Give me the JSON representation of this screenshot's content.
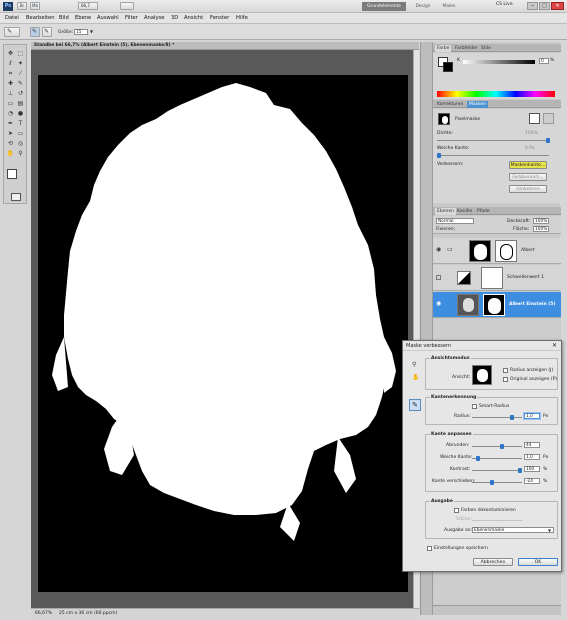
{
  "appbar": {
    "zoom": "66,7",
    "workspace_btn": "Grundelemente",
    "btn_design": "Design",
    "btn_malen": "Malen",
    "cs_live": "CS Live"
  },
  "menu": [
    "Datei",
    "Bearbeiten",
    "Bild",
    "Ebene",
    "Auswahl",
    "Filter",
    "Analyse",
    "3D",
    "Ansicht",
    "Fenster",
    "Hilfe"
  ],
  "options": {
    "size_label": "Größe:",
    "size_value": "15"
  },
  "document": {
    "title": "Standbe bei 66,7% (Albert Einstein (5), Ebenenmaske/8) *",
    "status_zoom": "66,67%",
    "status_info": "25 cm x 36 cm (60 ppcm)"
  },
  "panels": {
    "color_tabs": [
      "Farbe",
      "Farbfelder",
      "Stile"
    ],
    "color_slider_label": "K",
    "color_slider_value": "0",
    "color_slider_unit": "%",
    "adjust_tabs": [
      "Korrekturen",
      "Masken"
    ],
    "mask_title": "Pixelmaske",
    "density_label": "Dichte:",
    "density_value": "100%",
    "feather_label": "Weiche Kante:",
    "feather_value": "0 Px",
    "refine_label": "Verbessern:",
    "btn_mask_edge": "Maskenkante...",
    "btn_color_range": "Farbbereich...",
    "btn_invert": "Umkehren",
    "layers_tabs": [
      "Ebenen",
      "Kanäle",
      "Pfade"
    ],
    "blend_mode": "Normal",
    "opacity_label": "Deckkraft:",
    "opacity_value": "100%",
    "lock_label": "Fixieren:",
    "fill_label": "Fläche:",
    "fill_value": "100%",
    "layers": [
      {
        "name": "Albert"
      },
      {
        "name": "Schwellenwert 1"
      },
      {
        "name": "Albert Einstein (5)"
      }
    ]
  },
  "dialog": {
    "title": "Maske verbessern",
    "view_group": "Ansichtsmodus",
    "view_label": "Ansicht:",
    "show_radius": "Radius anzeigen (J)",
    "show_original": "Original anzeigen (P)",
    "edge_group": "Kantenerkennung",
    "smart_radius": "Smart-Radius",
    "radius_label": "Radius:",
    "radius_value": "1,0",
    "radius_unit": "Px",
    "adjust_group": "Kante anpassen",
    "smooth_label": "Abrunden:",
    "smooth_value": "44",
    "feather_label": "Weiche Kante:",
    "feather_value": "1,0",
    "feather_unit": "Px",
    "contrast_label": "Kontrast:",
    "contrast_value": "100",
    "contrast_unit": "%",
    "shift_label": "Kante verschieben:",
    "shift_value": "-24",
    "shift_unit": "%",
    "output_group": "Ausgabe",
    "decontam": "Farben dekontaminieren",
    "amount_label": "Stärke:",
    "output_to_label": "Ausgabe an:",
    "output_to_value": "Ebenenmaske",
    "remember": "Einstellungen speichern",
    "cancel": "Abbrechen",
    "ok": "OK"
  }
}
